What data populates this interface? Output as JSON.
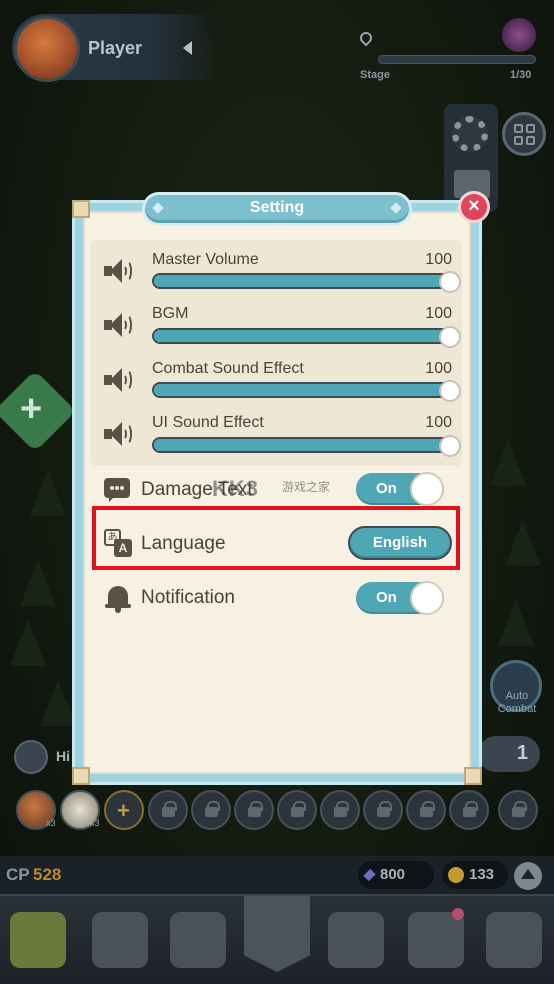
{
  "hud": {
    "player_name": "Player",
    "stage_label": "Stage",
    "stage_count": "1/30",
    "icons": [
      "avatar",
      "pin-icon",
      "boss-icon",
      "gear-icon",
      "grid-icon",
      "mail-icon"
    ]
  },
  "side": {
    "add_icon": "+",
    "auto_label": "Auto\nCombat",
    "count": "1",
    "hide_label": "Hi"
  },
  "slots": {
    "hero_count_1": "x3",
    "hero_count_2": "x3",
    "add_icon": "+",
    "locked_count": 9
  },
  "currency": {
    "cp_label": "CP",
    "cp_value": "528",
    "gems": "800",
    "coins": "133"
  },
  "modal": {
    "title": "Setting",
    "close_icon": "×",
    "volumes": [
      {
        "label": "Master Volume",
        "value": "100",
        "level": 100
      },
      {
        "label": "BGM",
        "value": "100",
        "level": 100
      },
      {
        "label": "Combat Sound Effect",
        "value": "100",
        "level": 100
      },
      {
        "label": "UI Sound Effect",
        "value": "100",
        "level": 100
      }
    ],
    "damage_text": {
      "label": "Damage Text",
      "state": "On"
    },
    "language": {
      "label": "Language",
      "value": "English",
      "icon_a1": "あ",
      "icon_a2": "A"
    },
    "notification": {
      "label": "Notification",
      "state": "On"
    }
  },
  "watermark": {
    "text": "KK3",
    "sub": "游戏之家"
  },
  "colors": {
    "accent_teal": "#4fa7b6",
    "panel_bg": "#f7f1e4",
    "highlight": "#e0131d",
    "close_red": "#e0455a"
  }
}
